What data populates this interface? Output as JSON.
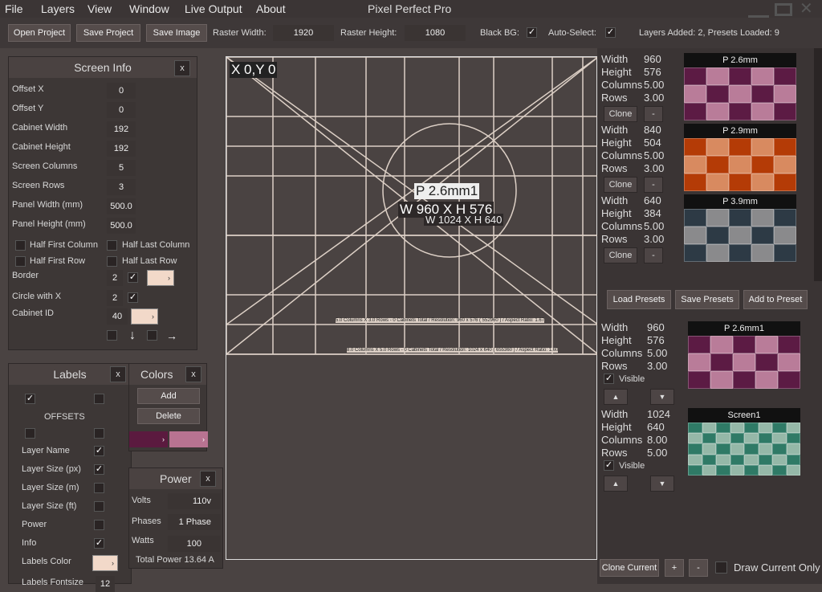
{
  "app": {
    "title": "Pixel Perfect Pro"
  },
  "menu": [
    "File",
    "Layers",
    "View",
    "Window",
    "Live Output",
    "About"
  ],
  "toolbar": {
    "open": "Open Project",
    "save": "Save Project",
    "save_image": "Save Image",
    "raster_width_label": "Raster Width:",
    "raster_width": "1920",
    "raster_height_label": "Raster Height:",
    "raster_height": "1080",
    "black_bg_label": "Black BG:",
    "auto_select_label": "Auto-Select:",
    "status": "Layers Added: 2, Presets Loaded: 9"
  },
  "screen_info": {
    "title": "Screen Info",
    "close": "x",
    "fields": [
      {
        "label": "Offset X",
        "value": "0"
      },
      {
        "label": "Offset Y",
        "value": "0"
      },
      {
        "label": "Cabinet Width",
        "value": "192"
      },
      {
        "label": "Cabinet Height",
        "value": "192"
      },
      {
        "label": "Screen Columns",
        "value": "5"
      },
      {
        "label": "Screen Rows",
        "value": "3"
      },
      {
        "label": "Panel Width  (mm)",
        "value": "500.0"
      },
      {
        "label": "Panel Height (mm)",
        "value": "500.0"
      }
    ],
    "half_first_column": "Half First Column",
    "half_last_column": "Half Last Column",
    "half_first_row": "Half First Row",
    "half_last_row": "Half Last Row",
    "border_label": "Border",
    "border_value": "2",
    "circle_label": "Circle with X",
    "circle_value": "2",
    "cabinet_id_label": "Cabinet ID",
    "cabinet_id_value": "40",
    "arrow_down": "↓",
    "arrow_right": "→"
  },
  "labels_panel": {
    "title": "Labels",
    "close": "x",
    "offsets": "OFFSETS",
    "items": [
      {
        "label": "Layer Name",
        "checked": "✓"
      },
      {
        "label": "Layer Size (px)",
        "checked": "✓"
      },
      {
        "label": "Layer Size (m)",
        "checked": ""
      },
      {
        "label": "Layer Size (ft)",
        "checked": ""
      },
      {
        "label": "Power",
        "checked": ""
      },
      {
        "label": "Info",
        "checked": "✓"
      }
    ],
    "labels_color": "Labels Color",
    "labels_fontsize": "Labels Fontsize",
    "labels_fontsize_value": "12"
  },
  "colors_panel": {
    "title": "Colors",
    "close": "x",
    "add": "Add",
    "delete": "Delete",
    "color1": "#5b1a3f",
    "color2": "#b87391"
  },
  "power_panel": {
    "title": "Power",
    "close": "x",
    "volts_label": "Volts",
    "volts": "110v",
    "phases_label": "Phases",
    "phases": "1 Phase",
    "watts_label": "Watts",
    "watts": "100",
    "total": "Total Power 13.64 A"
  },
  "canvas": {
    "origin": "X 0,Y 0",
    "layer_name": "P 2.6mm1",
    "layer_size": "W 960 X H 576",
    "screen_size": "W 1024 X H 640",
    "info1": "5.0 Columns X 3.0 Rows - 0 Cabinets Total / Resolution: 960 x 576 ( 552960 ) / Aspect Ratio: 1.67",
    "info2": "8.0 Columns X 5.0 Rows - 0 Cabinets Total / Resolution: 1024 x 640 ( 655360 ) / Aspect Ratio: 1.60"
  },
  "presets": [
    {
      "width": "960",
      "height": "576",
      "columns": "5.00",
      "rows": "3.00",
      "name": "P 2.6mm",
      "c1": "#5c1b44",
      "c2": "#b97c99"
    },
    {
      "width": "840",
      "height": "504",
      "columns": "5.00",
      "rows": "3.00",
      "name": "P 2.9mm",
      "c1": "#b43b06",
      "c2": "#d88a60"
    },
    {
      "width": "640",
      "height": "384",
      "columns": "5.00",
      "rows": "3.00",
      "name": "P 3.9mm",
      "c1": "#2d3a45",
      "c2": "#8a8a8c"
    }
  ],
  "preset_labels": {
    "width": "Width",
    "height": "Height",
    "columns": "Columns",
    "rows": "Rows",
    "clone": "Clone",
    "minus": "-"
  },
  "preset_actions": {
    "load": "Load Presets",
    "save": "Save Presets",
    "add": "Add to Preset"
  },
  "layers": [
    {
      "width": "960",
      "height": "576",
      "columns": "5.00",
      "rows": "3.00",
      "name": "P 2.6mm1",
      "visible": "Visible",
      "c1": "#5c1b44",
      "c2": "#b97c99",
      "cols": 5,
      "rws": 3
    },
    {
      "width": "1024",
      "height": "640",
      "columns": "8.00",
      "rows": "5.00",
      "name": "Screen1",
      "visible": "Visible",
      "c1": "#2f7a66",
      "c2": "#95b8a8",
      "cols": 8,
      "rws": 5
    }
  ],
  "bottom": {
    "clone_current": "Clone Current",
    "plus": "+",
    "minus": "-",
    "draw_current": "Draw Current Only"
  },
  "arrows": {
    "up": "▲",
    "down": "▼",
    "dropdown": "›"
  }
}
